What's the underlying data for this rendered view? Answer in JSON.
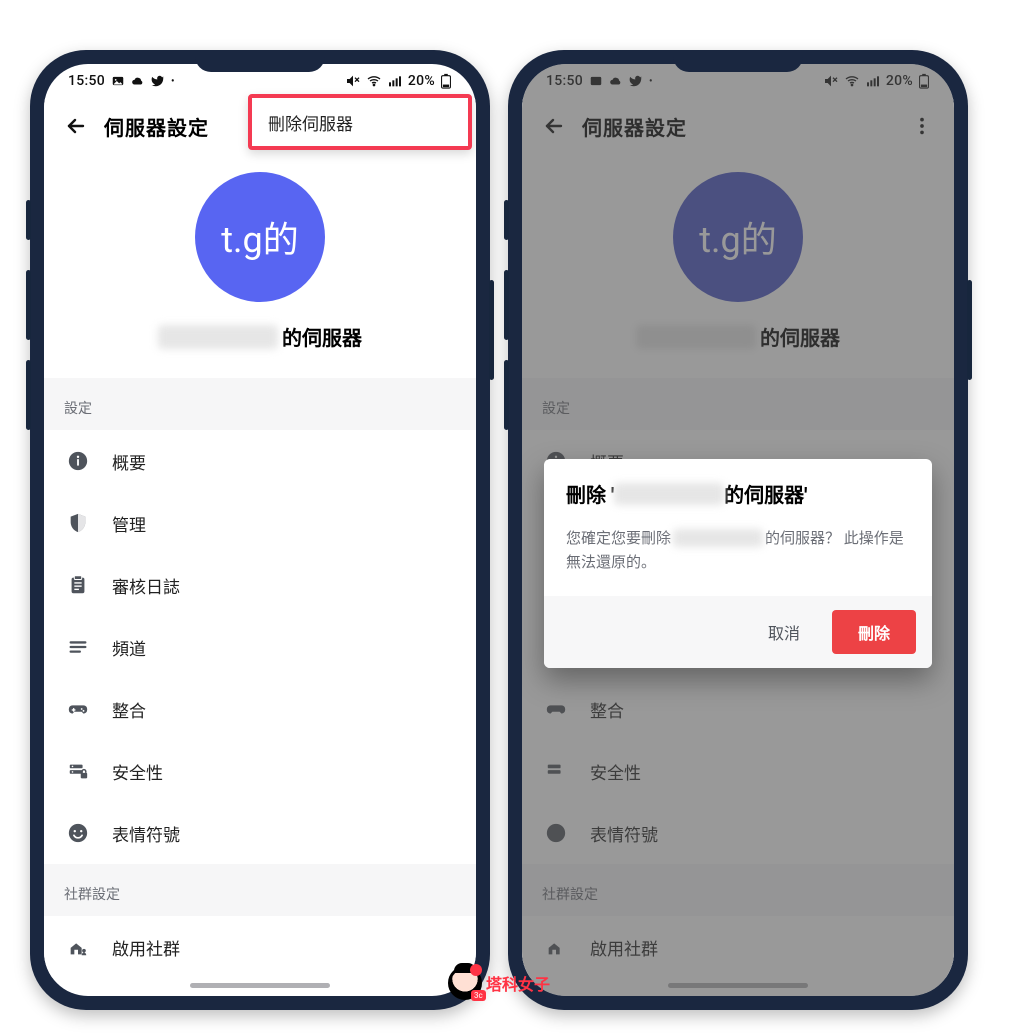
{
  "status": {
    "time": "15:50",
    "battery": "20%"
  },
  "header": {
    "title": "伺服器設定"
  },
  "menu": {
    "delete_server": "刪除伺服器"
  },
  "server": {
    "avatar_text": "t.g的",
    "name_suffix": "的伺服器"
  },
  "sections": {
    "settings": "設定",
    "community": "社群設定"
  },
  "settings_items": [
    {
      "id": "overview",
      "label": "概要",
      "icon": "info"
    },
    {
      "id": "manage",
      "label": "管理",
      "icon": "shield"
    },
    {
      "id": "audit",
      "label": "審核日誌",
      "icon": "clipboard"
    },
    {
      "id": "channels",
      "label": "頻道",
      "icon": "list"
    },
    {
      "id": "integrations",
      "label": "整合",
      "icon": "gamepad"
    },
    {
      "id": "security",
      "label": "安全性",
      "icon": "server-lock"
    },
    {
      "id": "emoji",
      "label": "表情符號",
      "icon": "emoji"
    }
  ],
  "community_items": [
    {
      "id": "enable-community",
      "label": "啟用社群",
      "icon": "community"
    }
  ],
  "dialog": {
    "title_prefix": "刪除 '",
    "title_suffix": "的伺服器'",
    "body_prefix": "您確定您要刪除",
    "body_mid": "的伺服器？ 此操作是",
    "body_end": "無法還原的。",
    "cancel": "取消",
    "delete": "刪除"
  },
  "watermark": {
    "text": "塔科女子",
    "badge": "3c"
  }
}
